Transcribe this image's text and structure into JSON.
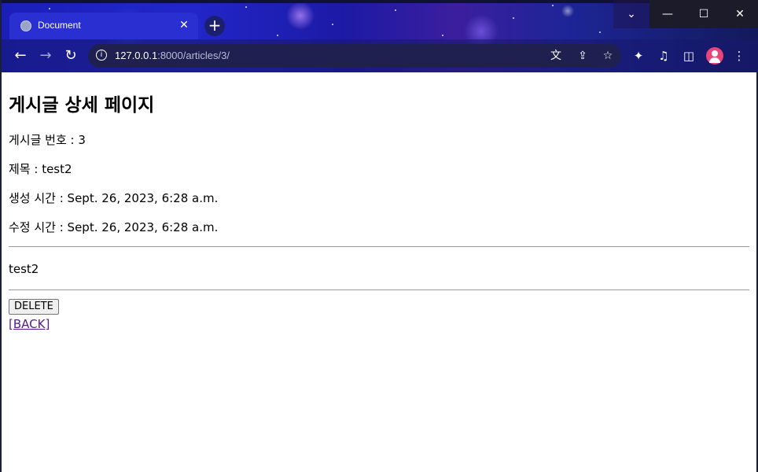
{
  "browser": {
    "tab_title": "Document",
    "tab_close": "✕",
    "new_tab": "+",
    "url_host": "127.0.0.1",
    "url_rest": ":8000/articles/3/",
    "window_controls": {
      "dropdown": "⌄",
      "minimize": "—",
      "maximize": "☐",
      "close": "✕"
    },
    "icons": [
      "back-arrow-icon",
      "forward-arrow-icon",
      "reload-icon",
      "info-icon",
      "translate-icon",
      "share-icon",
      "star-icon",
      "extensions-icon",
      "media-icon",
      "side-panel-icon",
      "profile-icon",
      "menu-dots-icon"
    ]
  },
  "page": {
    "heading": "게시글 상세 페이지",
    "article_number": "게시글 번호 : 3",
    "title_line": "제목 : test2",
    "created_line": "생성 시간 : Sept. 26, 2023, 6:28 a.m.",
    "updated_line": "수정 시간 : Sept. 26, 2023, 6:28 a.m.",
    "body": "test2",
    "delete_label": "DELETE",
    "back_label": "[BACK]"
  },
  "colors": {
    "link_visited": "#551a8b",
    "rule": "#9a9a9a"
  }
}
